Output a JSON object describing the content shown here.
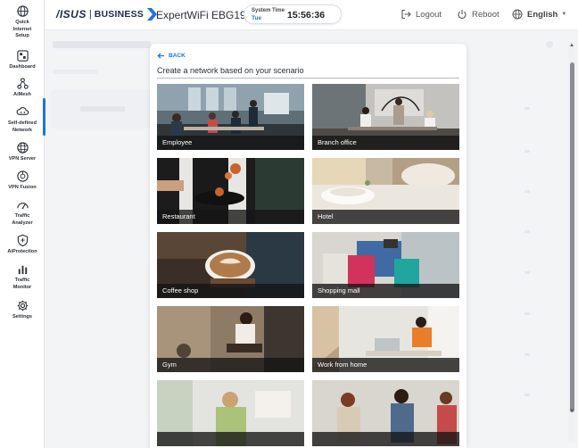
{
  "header": {
    "brand_asus": "/ISUS",
    "brand_separator": "|",
    "brand_business": "BUSINESS",
    "model": "ExpertWiFi EBG19P",
    "system_time_label": "System Time",
    "system_time_day": "Tue",
    "system_time_clock": "15:56:36",
    "logout_label": "Logout",
    "reboot_label": "Reboot",
    "language_label": "English"
  },
  "sidebar": {
    "items": [
      {
        "label": "Quick\nInternet\nSetup",
        "icon": "globe-gear-icon"
      },
      {
        "label": "Dashboard",
        "icon": "dashboard-icon"
      },
      {
        "label": "AiMesh",
        "icon": "aimesh-icon"
      },
      {
        "label": "Self-defined\nNetwork",
        "icon": "network-cloud-icon"
      },
      {
        "label": "VPN Server",
        "icon": "vpn-globe-icon"
      },
      {
        "label": "VPN Fusion",
        "icon": "vpn-fusion-icon"
      },
      {
        "label": "Traffic\nAnalyzer",
        "icon": "analyzer-icon"
      },
      {
        "label": "AiProtection",
        "icon": "shield-icon"
      },
      {
        "label": "Traffic\nMonitor",
        "icon": "bar-chart-icon"
      },
      {
        "label": "Settings",
        "icon": "gear-icon"
      }
    ],
    "active_index": 3
  },
  "modal": {
    "back_label": "BACK",
    "title": "Create a network based on your scenario",
    "scenarios": [
      {
        "label": "Employee"
      },
      {
        "label": "Branch office"
      },
      {
        "label": "Restaurant"
      },
      {
        "label": "Hotel"
      },
      {
        "label": "Coffee shop"
      },
      {
        "label": "Shopping mall"
      },
      {
        "label": "Gym"
      },
      {
        "label": "Work from home"
      },
      {
        "label": ""
      },
      {
        "label": ""
      }
    ]
  },
  "colors": {
    "accent": "#1a73e8",
    "sidebar_text": "#2a2f3a",
    "tile_bar": "#141414"
  }
}
